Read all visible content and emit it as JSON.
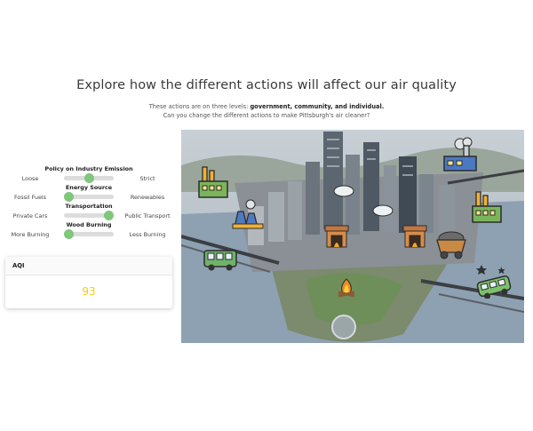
{
  "header": {
    "title": "Explore how the different actions will affect our air quality",
    "subtitle_prefix": "These actions are on three levels: ",
    "subtitle_bold": "government, community, and individual.",
    "subtitle_line2": "Can you change the different actions to make Pittsburgh's air cleaner?"
  },
  "controls": [
    {
      "title": "Policy on Industry Emission",
      "left": "Loose",
      "right": "Strict",
      "value_pct": 50
    },
    {
      "title": "Energy Source",
      "left": "Fossil Fuels",
      "right": "Renewables",
      "value_pct": 10
    },
    {
      "title": "Transportation",
      "left": "Private Cars",
      "right": "Public Transport",
      "value_pct": 90
    },
    {
      "title": "Wood Burning",
      "left": "More Burning",
      "right": "Less Burning",
      "value_pct": 10
    }
  ],
  "aqi": {
    "label": "AQI",
    "value": "93",
    "color": "#f2cc0c"
  },
  "colors": {
    "slider_thumb": "#7fc77b",
    "slider_track": "#dcdcdc",
    "river": "#8ea1b2"
  },
  "scene": {
    "icons": [
      "factory-icon",
      "factory-icon",
      "factory-icon",
      "power-plant-icon",
      "factory-icon",
      "fireplace-icon",
      "fireplace-icon",
      "coal-cart-icon",
      "bus-icon",
      "bus-icon",
      "campfire-icon"
    ]
  }
}
